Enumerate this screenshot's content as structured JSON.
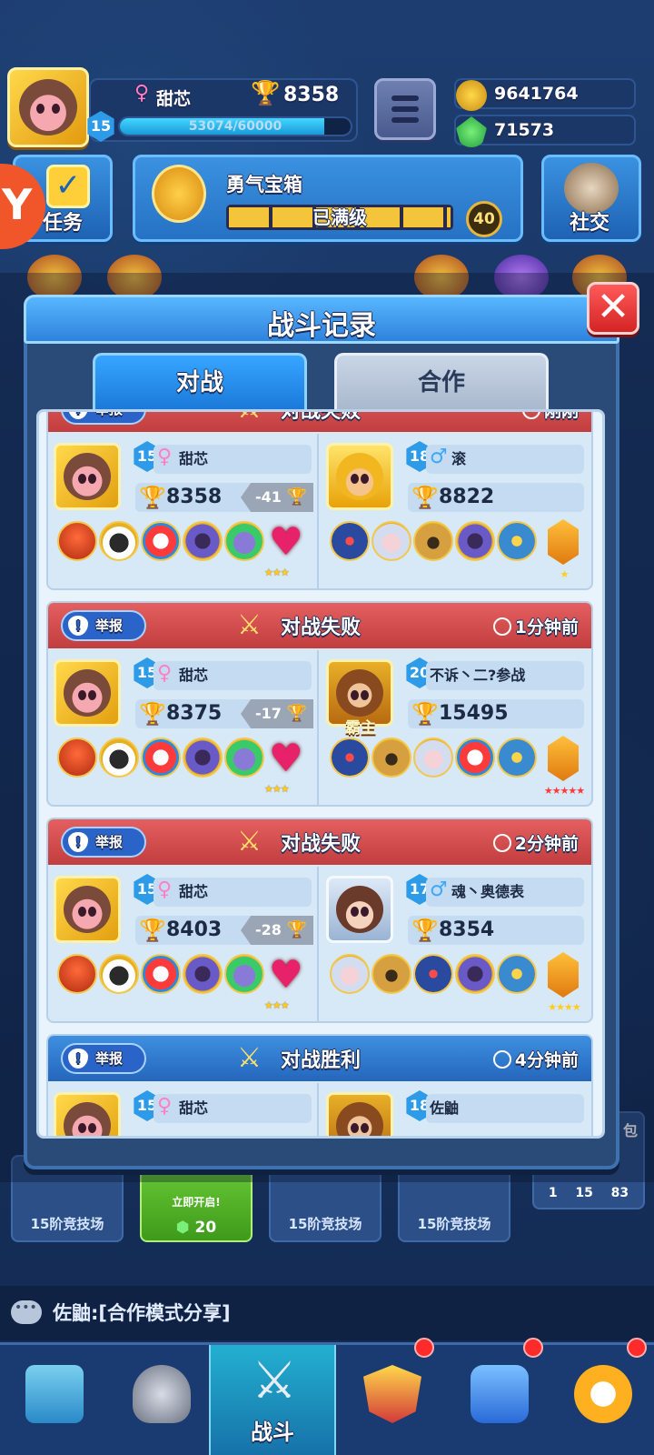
{
  "hud": {
    "player_name": "甜芯",
    "trophies": "8358",
    "level": "15",
    "xp_text": "53074/60000",
    "xp_fraction": 0.885,
    "gold": "9641764",
    "gems": "71573",
    "task_label": "任务",
    "chest_title": "勇气宝箱",
    "chest_status": "已满级",
    "chest_count": "40",
    "social_label": "社交"
  },
  "modal": {
    "title": "战斗记录",
    "close_symbol": "✕",
    "tabs": [
      {
        "label": "对战",
        "active": true
      },
      {
        "label": "合作",
        "active": false
      }
    ]
  },
  "records": [
    {
      "result": "对战失败",
      "time": "刚刚",
      "report": "举报",
      "me": {
        "level": "15",
        "name": "甜芯",
        "trophies": "8358",
        "delta": "-41"
      },
      "opp": {
        "level": "18",
        "name": "滚",
        "trophies": "8822",
        "gem_stars": "★"
      }
    },
    {
      "result": "对战失败",
      "time": "1分钟前",
      "report": "举报",
      "me": {
        "level": "15",
        "name": "甜芯",
        "trophies": "8375",
        "delta": "-17"
      },
      "opp": {
        "level": "20",
        "name": "不诉丶二?参战",
        "trophies": "15495",
        "badge": "霸主",
        "gem_stars": "★★★★★"
      }
    },
    {
      "result": "对战失败",
      "time": "2分钟前",
      "report": "举报",
      "me": {
        "level": "15",
        "name": "甜芯",
        "trophies": "8403",
        "delta": "-28"
      },
      "opp": {
        "level": "17",
        "name": "魂丶奥德表",
        "trophies": "8354",
        "gem_stars": "★★★★"
      }
    },
    {
      "result": "对战胜利",
      "time": "4分钟前",
      "report": "举报",
      "me": {
        "level": "15",
        "name": "甜芯"
      },
      "opp": {
        "level": "18",
        "name": "佐鼬"
      }
    }
  ],
  "heart_stars": "★★★",
  "chest_strip": {
    "items": [
      "15阶竞技场",
      "立即开启!",
      "15阶竞技场",
      "15阶竞技场"
    ],
    "open_cost": "20",
    "pack_label": "包",
    "pack_counts": [
      "1",
      "15",
      "83"
    ]
  },
  "chat": {
    "text": "佐鼬:[合作模式分享]"
  },
  "nav": {
    "active_label": "战斗"
  },
  "colors": {
    "loss_header": "#d44a4a",
    "win_header": "#2e78cc",
    "accent": "#2e83dc"
  }
}
